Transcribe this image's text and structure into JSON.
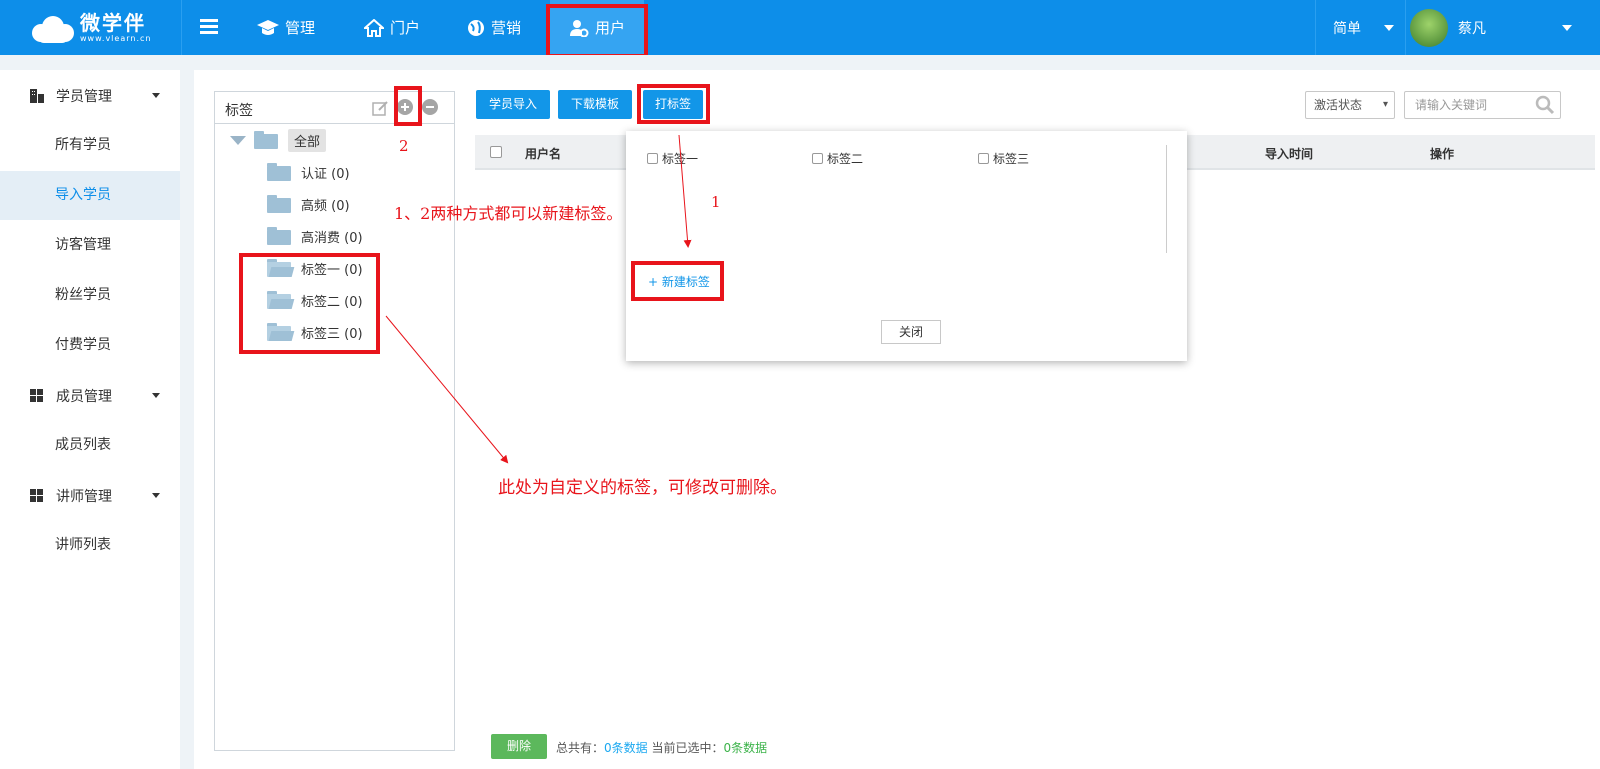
{
  "header": {
    "logo_main": "微学伴",
    "logo_sub": "www.vlearn.cn",
    "nav": [
      {
        "label": "管理",
        "icon": "graduation-cap-icon"
      },
      {
        "label": "门户",
        "icon": "home-icon"
      },
      {
        "label": "营销",
        "icon": "globe-icon"
      },
      {
        "label": "用户",
        "icon": "user-gear-icon"
      }
    ],
    "mode": "简单",
    "username": "蔡凡"
  },
  "sidebar": {
    "groups": [
      {
        "label": "学员管理",
        "icon": "building-icon",
        "items": [
          "所有学员",
          "导入学员",
          "访客管理",
          "粉丝学员",
          "付费学员"
        ]
      },
      {
        "label": "成员管理",
        "icon": "grid-icon",
        "items": [
          "成员列表"
        ]
      },
      {
        "label": "讲师管理",
        "icon": "grid-icon",
        "items": [
          "讲师列表"
        ]
      }
    ],
    "active_item": "导入学员"
  },
  "tag_panel": {
    "title": "标签",
    "tree": {
      "root": "全部",
      "children": [
        "认证 (0)",
        "高频 (0)",
        "高消费 (0)",
        "标签一 (0)",
        "标签二 (0)",
        "标签三 (0)"
      ]
    }
  },
  "toolbar": {
    "import_label": "学员导入",
    "download_label": "下载模板",
    "tag_label": "打标签",
    "status_select": "激活状态",
    "search_placeholder": "请输入关键词"
  },
  "table": {
    "columns": [
      "用户名",
      "导入时间",
      "操作"
    ]
  },
  "popup": {
    "options": [
      "标签一",
      "标签二",
      "标签三"
    ],
    "new_tag": "+ 新建标签",
    "close": "关闭"
  },
  "annotations": {
    "num1": "1",
    "num2": "2",
    "note_create": "1、2两种方式都可以新建标签。",
    "note_custom": "此处为自定义的标签，可修改可删除。"
  },
  "footer": {
    "delete": "删除",
    "total_prefix": "总共有：",
    "total_value": "0条数据",
    "selected_prefix": "当前已选中：",
    "selected_value": "0条数据"
  },
  "colors": {
    "primary": "#0d8ee9",
    "annotation_red": "#e8141b",
    "delete_green": "#5cb85c"
  }
}
